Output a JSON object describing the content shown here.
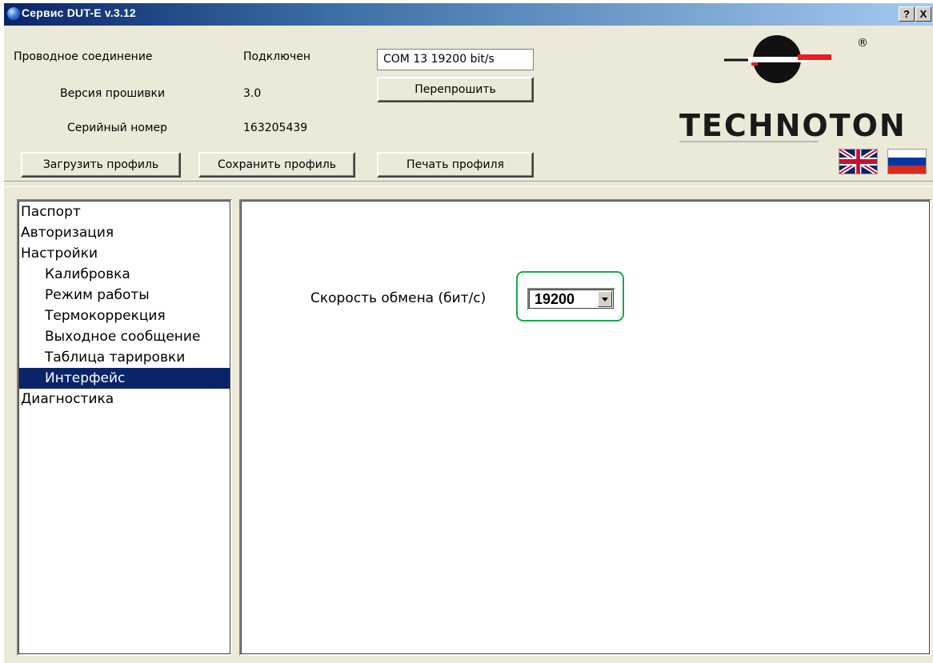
{
  "window": {
    "title": "Сервис DUT-E  v.3.12",
    "help_label": "?",
    "close_label": "X"
  },
  "info": {
    "connection_label": "Проводное соединение",
    "connection_value": "Подключен",
    "firmware_label": "Версия прошивки",
    "firmware_value": "3.0",
    "serial_label": "Серийный номер",
    "serial_value": "163205439",
    "port_value": "COM 13   19200 bit/s"
  },
  "buttons": {
    "reflash": "Перепрошить",
    "load_profile": "Загрузить профиль",
    "save_profile": "Сохранить профиль",
    "print_profile": "Печать профиля"
  },
  "logo": {
    "brand": "TECHNOTON",
    "registered": "®"
  },
  "languages": [
    "english-flag",
    "russian-flag"
  ],
  "tree": {
    "items": [
      {
        "label": "Паспорт",
        "level": 1,
        "selected": false
      },
      {
        "label": "Авторизация",
        "level": 1,
        "selected": false
      },
      {
        "label": "Настройки",
        "level": 1,
        "selected": false
      },
      {
        "label": "Калибровка",
        "level": 2,
        "selected": false
      },
      {
        "label": "Режим работы",
        "level": 2,
        "selected": false
      },
      {
        "label": "Термокоррекция",
        "level": 2,
        "selected": false
      },
      {
        "label": "Выходное сообщение",
        "level": 2,
        "selected": false
      },
      {
        "label": "Таблица тарировки",
        "level": 2,
        "selected": false
      },
      {
        "label": "Интерфейс",
        "level": 2,
        "selected": true
      },
      {
        "label": "Диагностика",
        "level": 1,
        "selected": false
      }
    ]
  },
  "interface": {
    "speed_label": "Скорость обмена (бит/с)",
    "speed_value": "19200"
  },
  "colors": {
    "selection": "#0a246a",
    "highlight_border": "#1aa94e",
    "logo_red": "#e31e24"
  }
}
